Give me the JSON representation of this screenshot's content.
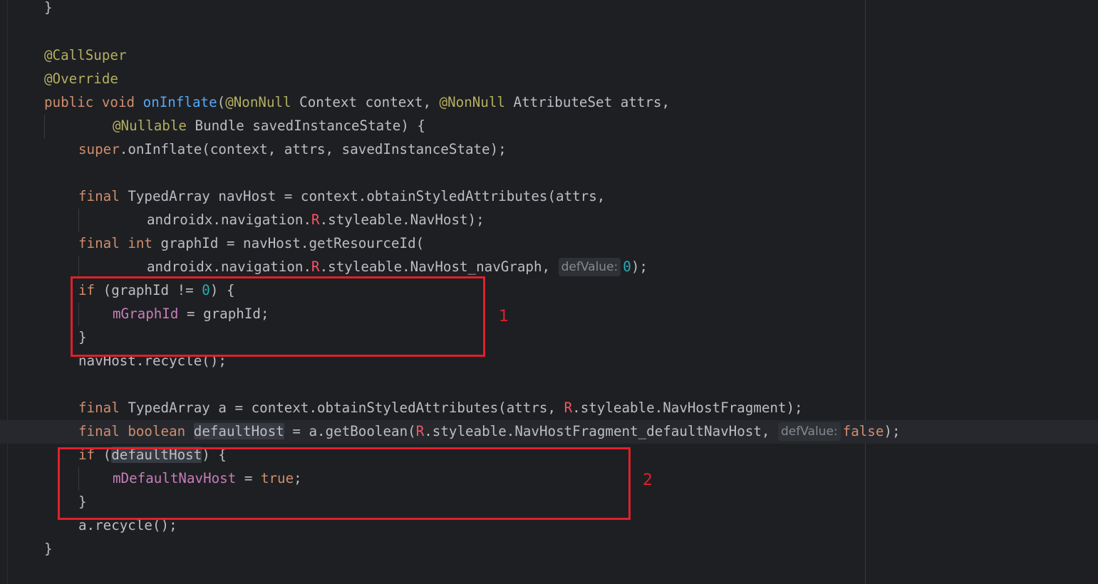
{
  "editor": {
    "closing_brace_top": "}",
    "annotation_callsuper": "@CallSuper",
    "annotation_override": "@Override",
    "sig": {
      "kw_public": "public",
      "kw_void": "void",
      "method_name": "onInflate",
      "open_paren": "(",
      "ann_nonnull_1": "@NonNull",
      "param_1": " Context context, ",
      "ann_nonnull_2": "@NonNull",
      "param_2": " AttributeSet attrs,"
    },
    "sig_cont": {
      "ann_nullable": "@Nullable",
      "param_3": " Bundle savedInstanceState) {"
    },
    "super_call": {
      "kw_super": "super",
      "rest": ".onInflate(context, attrs, savedInstanceState);"
    },
    "navhost_decl": {
      "kw_final": "final",
      "rest": " TypedArray navHost = context.obtainStyledAttributes(attrs,"
    },
    "navhost_cont": {
      "prefix": "androidx.navigation.",
      "r": "R",
      "rest": ".styleable.NavHost);"
    },
    "graphid_decl": {
      "kw_final": "final",
      "kw_int": "int",
      "rest": " graphId = navHost.getResourceId("
    },
    "graphid_cont": {
      "prefix": "androidx.navigation.",
      "r": "R",
      "rest": ".styleable.NavHost_navGraph, ",
      "hint": "defValue:",
      "num": "0",
      "close": ");"
    },
    "if_graph": {
      "kw_if": "if",
      "pre": " (graphId != ",
      "num": "0",
      "post": ") {"
    },
    "assign_graph": {
      "field": "mGraphId",
      "rest": " = graphId;"
    },
    "close_brace_1": "}",
    "navhost_recycle": "navHost.recycle();",
    "a_decl": {
      "kw_final": "final",
      "pre": " TypedArray a = context.obtainStyledAttributes(attrs, ",
      "r": "R",
      "rest": ".styleable.NavHostFragment);"
    },
    "defaulthost_decl": {
      "kw_final": "final",
      "kw_boolean": "boolean",
      "var": "defaultHost",
      "pre": " = a.getBoolean(",
      "r": "R",
      "rest": ".styleable.NavHostFragment_defaultNavHost, ",
      "hint": "defValue:",
      "kw_false": "false",
      "close": ");"
    },
    "if_default": {
      "kw_if": "if",
      "open": " (",
      "var": "defaultHost",
      "close": ") {"
    },
    "assign_default": {
      "field": "mDefaultNavHost",
      "eq": " = ",
      "kw_true": "true",
      "semi": ";"
    },
    "close_brace_2": "}",
    "a_recycle": "a.recycle();",
    "closing_brace_end": "}"
  },
  "annotations": {
    "marker_1": "1",
    "marker_2": "2",
    "box_color": "#e0202b"
  },
  "colors": {
    "background": "#1e1f22",
    "keyword": "#cf8e6d",
    "annotation": "#b3ae60",
    "method": "#56a8f5",
    "field": "#c77dbb",
    "number": "#2aacb8"
  }
}
